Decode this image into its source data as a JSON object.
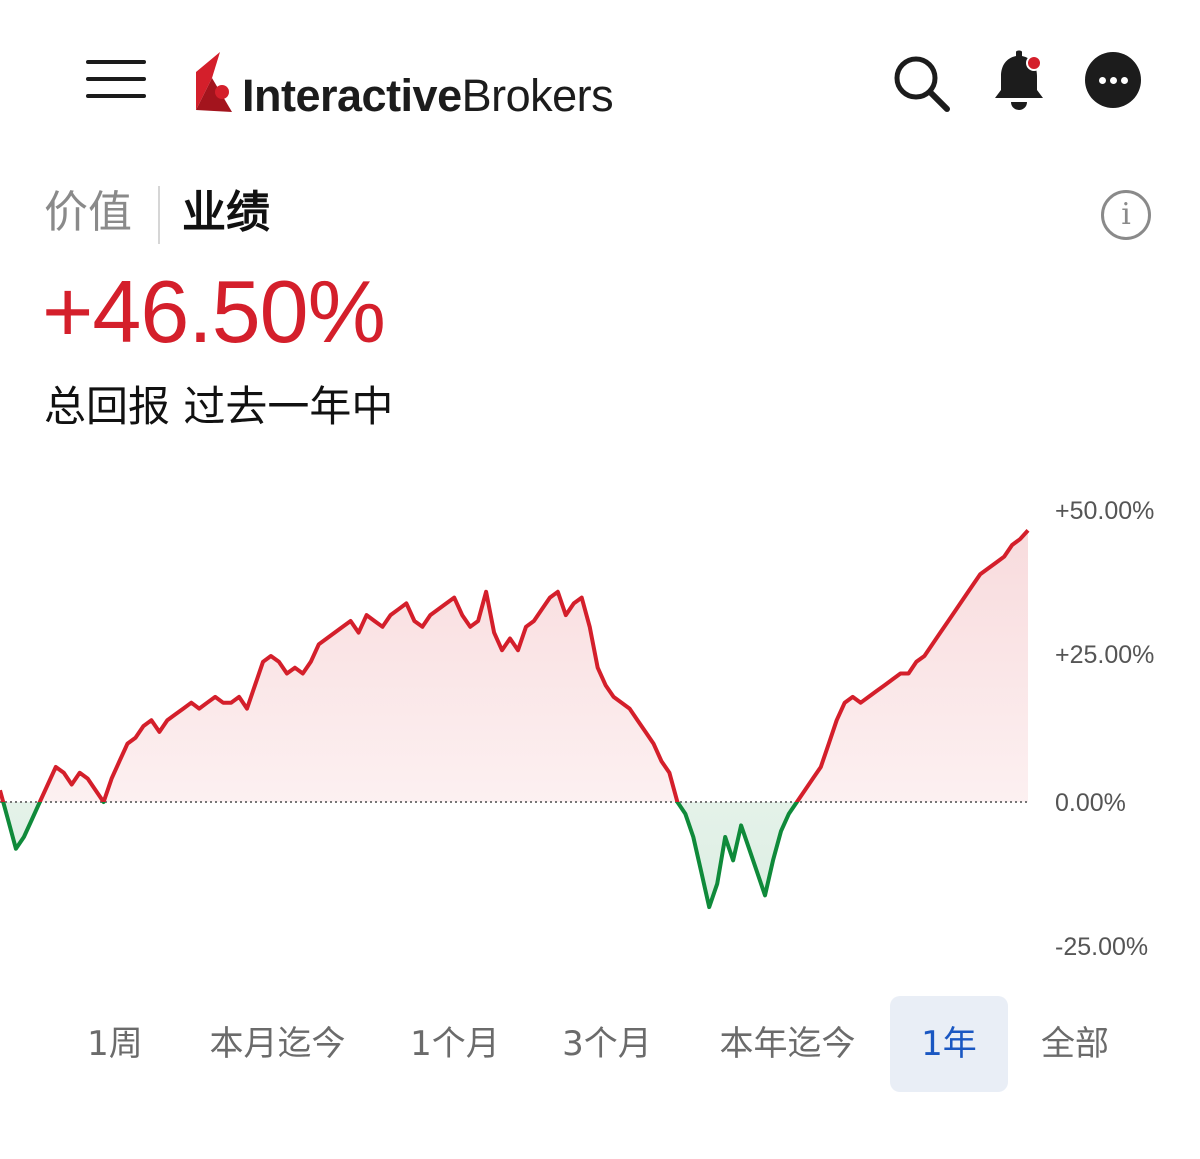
{
  "header": {
    "logo_bold": "Interactive",
    "logo_regular": "Brokers",
    "brand_color": "#d41f2b",
    "icons": [
      "menu-icon",
      "search-icon",
      "bell-icon",
      "more-icon"
    ],
    "notification_dot": true
  },
  "tabs": [
    {
      "label": "价值",
      "active": false
    },
    {
      "label": "业绩",
      "active": true
    }
  ],
  "info_glyph": "i",
  "summary": {
    "total_return": "+46.50%",
    "caption": "总回报 过去一年中",
    "positive_color": "#d41f2b"
  },
  "ranges": [
    {
      "label": "1周",
      "active": false
    },
    {
      "label": "本月迄今",
      "active": false
    },
    {
      "label": "1个月",
      "active": false
    },
    {
      "label": "3个月",
      "active": false
    },
    {
      "label": "本年迄今",
      "active": false
    },
    {
      "label": "1年",
      "active": true
    },
    {
      "label": "全部",
      "active": false
    }
  ],
  "chart_data": {
    "type": "area",
    "title": "",
    "xlabel": "",
    "ylabel": "",
    "y_ticks": [
      "+50.00%",
      "+25.00%",
      "0.00%",
      "-25.00%"
    ],
    "ylim": [
      -25,
      50
    ],
    "baseline": 0,
    "grid": false,
    "positive_color": "#d41f2b",
    "negative_color": "#0f8a3a",
    "series": [
      {
        "values": [
          2,
          -3,
          -8,
          -6,
          -3,
          0,
          3,
          6,
          5,
          3,
          5,
          4,
          2,
          0,
          4,
          7,
          10,
          11,
          13,
          14,
          12,
          14,
          15,
          16,
          17,
          16,
          17,
          18,
          17,
          17,
          18,
          16,
          20,
          24,
          25,
          24,
          22,
          23,
          22,
          24,
          27,
          28,
          29,
          30,
          31,
          29,
          32,
          31,
          30,
          32,
          33,
          34,
          31,
          30,
          32,
          33,
          34,
          35,
          32,
          30,
          31,
          36,
          29,
          26,
          28,
          26,
          30,
          31,
          33,
          35,
          36,
          32,
          34,
          35,
          30,
          23,
          20,
          18,
          17,
          16,
          14,
          12,
          10,
          7,
          5,
          0,
          -2,
          -6,
          -12,
          -18,
          -14,
          -6,
          -10,
          -4,
          -8,
          -12,
          -16,
          -10,
          -5,
          -2,
          0,
          2,
          4,
          6,
          10,
          14,
          17,
          18,
          17,
          18,
          19,
          20,
          21,
          22,
          22,
          24,
          25,
          27,
          29,
          31,
          33,
          35,
          37,
          39,
          40,
          41,
          42,
          44,
          45,
          46.5
        ]
      }
    ]
  }
}
